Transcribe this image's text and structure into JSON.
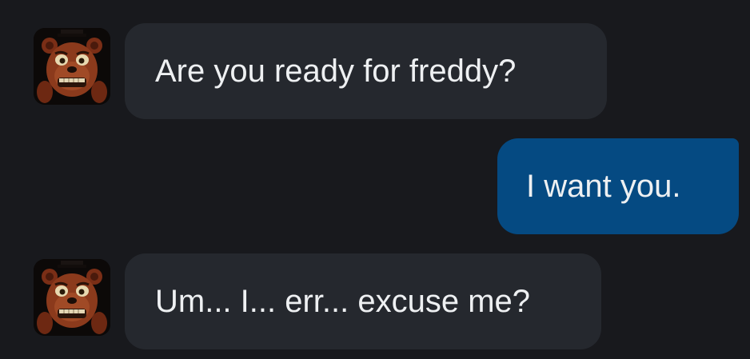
{
  "messages": [
    {
      "from": "bot",
      "text": "Are you ready for freddy?",
      "avatar": "freddy-fazbear-avatar"
    },
    {
      "from": "user",
      "text": "I want you."
    },
    {
      "from": "bot",
      "text": "Um... I... err... excuse me?",
      "avatar": "freddy-fazbear-avatar"
    }
  ],
  "colors": {
    "background": "#18191d",
    "incoming_bubble": "#25282e",
    "outgoing_bubble": "#054a82",
    "text": "#eef0f2"
  }
}
